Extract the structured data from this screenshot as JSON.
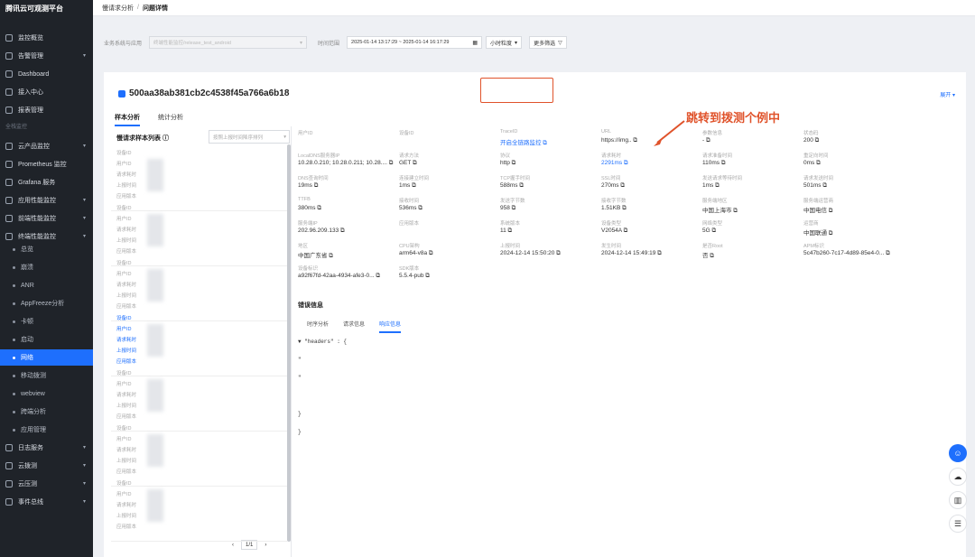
{
  "brand": "腾讯云可观测平台",
  "nav": [
    {
      "label": "监控概览",
      "icon": "dashboard-icon"
    },
    {
      "label": "告警管理",
      "icon": "bell-icon",
      "chevron": true
    },
    {
      "label": "Dashboard",
      "icon": "chart-icon"
    },
    {
      "label": "接入中心",
      "icon": "plug-icon"
    },
    {
      "label": "报表管理",
      "icon": "report-icon"
    }
  ],
  "nav_section": "全栈监控",
  "nav2": [
    {
      "label": "云产品监控",
      "chevron": true
    },
    {
      "label": "Prometheus 监控"
    },
    {
      "label": "Grafana 服务"
    },
    {
      "label": "应用性能监控",
      "chevron": true
    },
    {
      "label": "前端性能监控",
      "chevron": true
    },
    {
      "label": "终端性能监控",
      "chevron": true
    }
  ],
  "subnav": [
    "总览",
    "崩溃",
    "ANR",
    "AppFreeze分析",
    "卡顿",
    "启动",
    "网络",
    "移动拨测",
    "webview",
    "跨端分析",
    "应用管理"
  ],
  "nav3": [
    {
      "label": "日志服务",
      "chevron": true
    },
    {
      "label": "云拨测",
      "chevron": true
    },
    {
      "label": "云压测",
      "chevron": true
    },
    {
      "label": "事件总线",
      "chevron": true
    }
  ],
  "breadcrumb": {
    "parent": "慢请求分析",
    "sep": "/",
    "current": "问题详情"
  },
  "filters": {
    "scope_label": "业务系统与应用",
    "scope_value": "终端性能监控/release_test_android",
    "time_label": "时间范围",
    "time_value": "2025-01-14 13:17:29  ~ 2025-01-14 16:17:29",
    "granularity": "小时粒度",
    "more": "更多筛选"
  },
  "issue": {
    "hash": "500aa38ab381cb2c4538f45a766a6b18",
    "expand": "展开"
  },
  "tabs": [
    "样本分析",
    "统计分析"
  ],
  "list": {
    "title": "慢请求样本列表",
    "sort": "按照上报时间降序排列",
    "pager": "1/1"
  },
  "sample_fields": [
    "设备ID",
    "用户ID",
    "请求耗时",
    "上报时间",
    "应用版本"
  ],
  "info": [
    {
      "k": "用户ID",
      "v": ""
    },
    {
      "k": "设备ID",
      "v": ""
    },
    {
      "k": "TraceID",
      "v": "开启全链路监控",
      "link": true
    },
    {
      "k": "URL",
      "v": "https://img.."
    },
    {
      "k": "参数信息",
      "v": "-"
    },
    {
      "k": "状态码",
      "v": "200"
    },
    {
      "k": "LocalDNS服务器IP",
      "v": "10.28.0.210; 10.28.0.211; 10.28...."
    },
    {
      "k": "请求方法",
      "v": "GET"
    },
    {
      "k": "协议",
      "v": "http"
    },
    {
      "k": "请求耗时",
      "v": "2291ms",
      "link": true
    },
    {
      "k": "请求准备时间",
      "v": "110ms"
    },
    {
      "k": "重定向时间",
      "v": "0ms"
    },
    {
      "k": "DNS查询时间",
      "v": "19ms"
    },
    {
      "k": "连接建立时间",
      "v": "1ms"
    },
    {
      "k": "TCP握手时间",
      "v": "588ms"
    },
    {
      "k": "SSL时间",
      "v": "270ms"
    },
    {
      "k": "发送请求等待时间",
      "v": "1ms"
    },
    {
      "k": "请求发送时间",
      "v": "501ms"
    },
    {
      "k": "TTFB",
      "v": "380ms"
    },
    {
      "k": "接收时间",
      "v": "536ms"
    },
    {
      "k": "发送字节数",
      "v": "958"
    },
    {
      "k": "接收字节数",
      "v": "1.51KB"
    },
    {
      "k": "服务端地区",
      "v": "中国上海市"
    },
    {
      "k": "服务端运营商",
      "v": "中国电信"
    },
    {
      "k": "服务端IP",
      "v": "202.96.209.133"
    },
    {
      "k": "应用版本",
      "v": ""
    },
    {
      "k": "系统版本",
      "v": "11"
    },
    {
      "k": "设备类型",
      "v": "V2054A"
    },
    {
      "k": "网络类型",
      "v": "5G"
    },
    {
      "k": "运营商",
      "v": "中国联通"
    },
    {
      "k": "地区",
      "v": "中国广东省"
    },
    {
      "k": "CPU架构",
      "v": "arm64-v8a"
    },
    {
      "k": "上报时间",
      "v": "2024-12-14 15:50:20"
    },
    {
      "k": "发生时间",
      "v": "2024-12-14 15:49:19"
    },
    {
      "k": "是否Root",
      "v": "否"
    },
    {
      "k": "APM标识",
      "v": "5c47b260-7c17-4d89-85e4-0..."
    },
    {
      "k": "设备标识",
      "v": "a92f67fd-42aa-4934-afe3-0..."
    },
    {
      "k": "SDK版本",
      "v": "5.5.4-pub"
    }
  ],
  "err_title": "错误信息",
  "err_tabs": [
    "时序分析",
    "请求信息",
    "响应信息"
  ],
  "code": [
    "▼ \"headers\" : {",
    "   \"",
    "    \"",
    "",
    "   }",
    "}"
  ],
  "annotation": "跳转到拨测个例中"
}
